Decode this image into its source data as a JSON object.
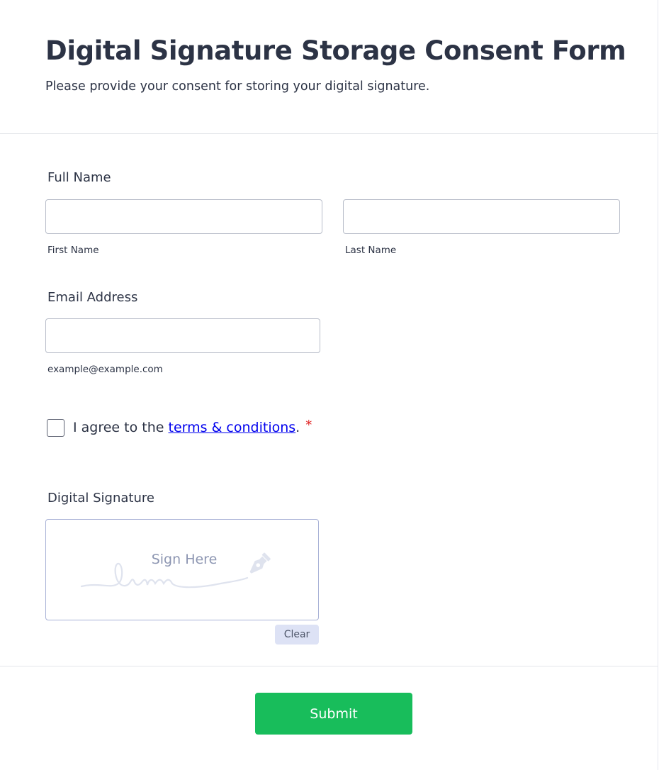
{
  "header": {
    "title": "Digital Signature Storage Consent Form",
    "subtitle": "Please provide your consent for storing your digital signature."
  },
  "full_name": {
    "label": "Full Name",
    "first_name": {
      "value": "",
      "sublabel": "First Name"
    },
    "last_name": {
      "value": "",
      "sublabel": "Last Name"
    }
  },
  "email": {
    "label": "Email Address",
    "value": "",
    "sublabel": "example@example.com"
  },
  "consent": {
    "checked": false,
    "text_before": "I agree to the ",
    "link_text": "terms & conditions",
    "text_after": ".",
    "required_mark": "*"
  },
  "signature": {
    "label": "Digital Signature",
    "placeholder": "Sign Here",
    "clear_label": "Clear",
    "pen_icon": "pen-nib-icon"
  },
  "submit": {
    "label": "Submit"
  },
  "colors": {
    "text": "#2c3345",
    "submit_bg": "#18bd5b",
    "link": "#0000ee",
    "required": "#e02020",
    "clear_bg": "#dde2f5",
    "signature_border": "#a8b1d6"
  }
}
